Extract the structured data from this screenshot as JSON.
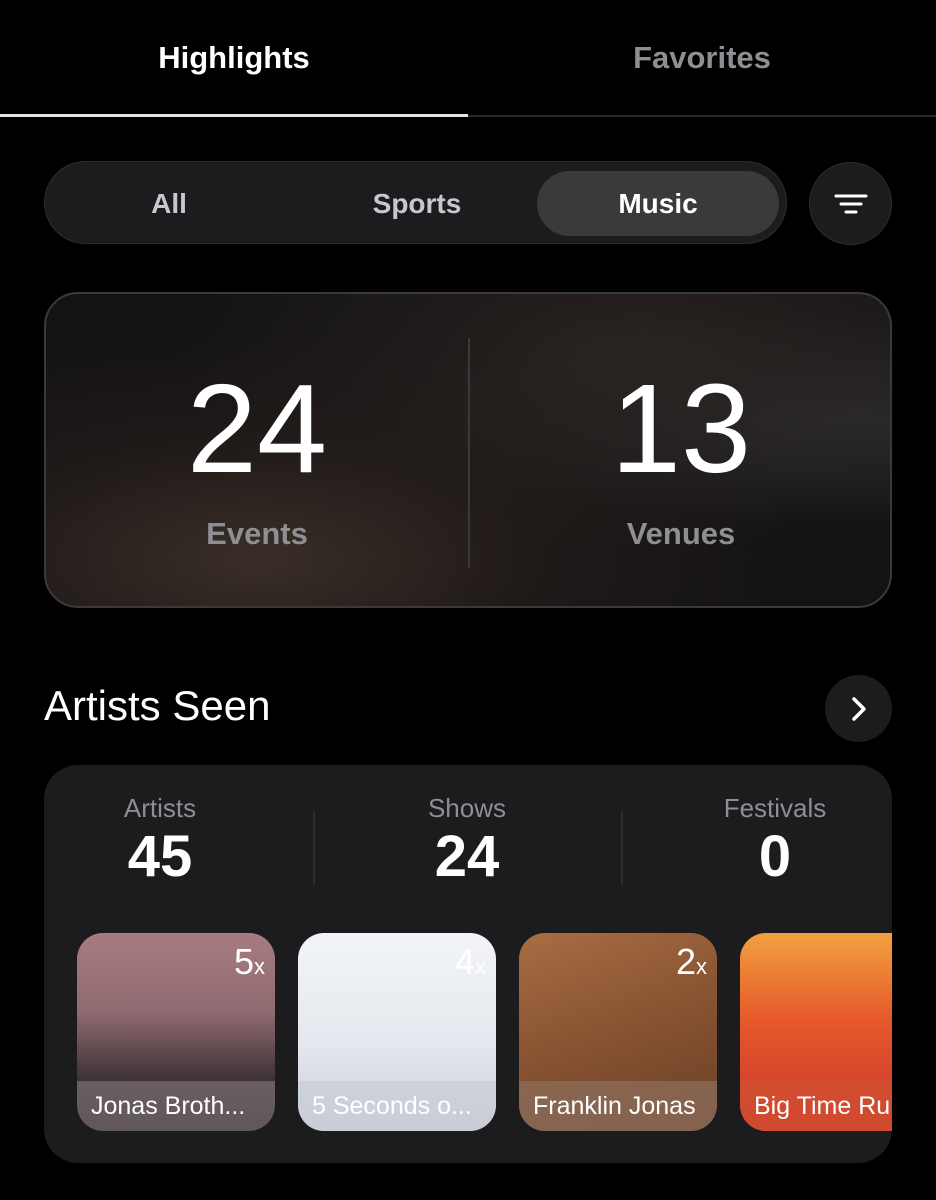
{
  "tabs": {
    "highlights": "Highlights",
    "favorites": "Favorites"
  },
  "segment": {
    "all": "All",
    "sports": "Sports",
    "music": "Music",
    "selected": "Music"
  },
  "stats": {
    "events_value": "24",
    "events_label": "Events",
    "venues_value": "13",
    "venues_label": "Venues"
  },
  "artists_section": {
    "title": "Artists Seen",
    "artists_label": "Artists",
    "artists_value": "45",
    "shows_label": "Shows",
    "shows_value": "24",
    "festivals_label": "Festivals",
    "festivals_value": "0",
    "tiles": [
      {
        "name": "Jonas Broth...",
        "count": "5",
        "suffix": "x"
      },
      {
        "name": "5 Seconds o...",
        "count": "4",
        "suffix": "x"
      },
      {
        "name": "Franklin Jonas",
        "count": "2",
        "suffix": "x"
      },
      {
        "name": "Big Time Ru",
        "count": "",
        "suffix": ""
      }
    ]
  },
  "icons": {
    "filter": "filter-lines-icon",
    "chevron": "chevron-right-icon"
  },
  "colors": {
    "background": "#000000",
    "card": "#1c1c1e",
    "muted_text": "#8e8e93",
    "selected_segment": "#3a3a3c"
  }
}
